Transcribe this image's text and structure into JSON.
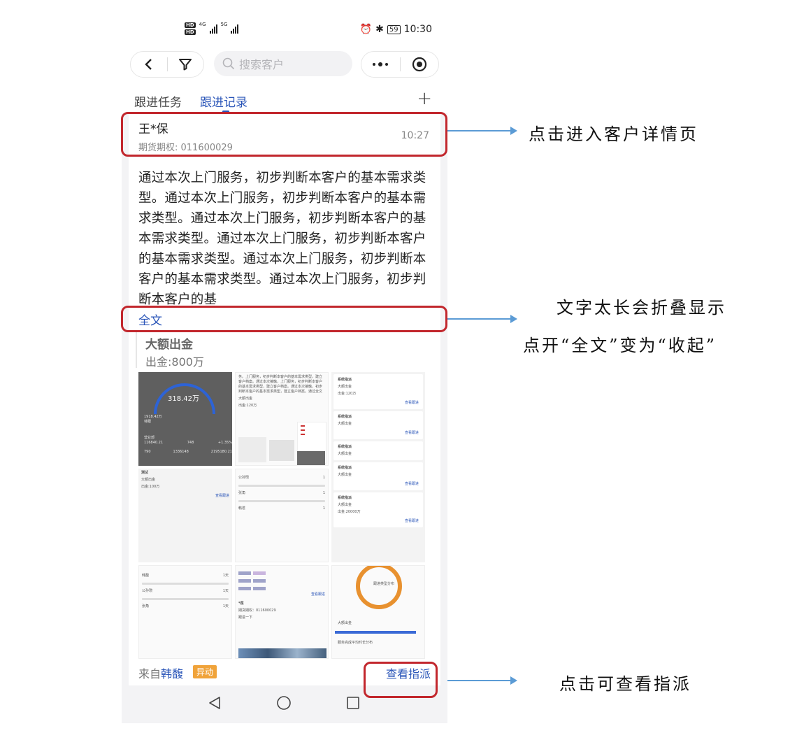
{
  "status_bar": {
    "network_1": "4G",
    "network_2": "5G",
    "hd_label": "HD",
    "battery": "59",
    "time": "10:30"
  },
  "nav": {
    "search_placeholder": "搜索客户",
    "more_icon": "more-dots-icon",
    "target_icon": "target-icon",
    "filter_icon": "filter-icon",
    "back_icon": "back-arrow-icon"
  },
  "tabs": {
    "tab1": "跟进任务",
    "tab2": "跟进记录",
    "active": "跟进记录",
    "add": "+"
  },
  "record": {
    "customer_name": "王*保",
    "customer_sub": "期货期权: 011600029",
    "time": "10:27",
    "body": "通过本次上门服务，初步判断本客户的基本需求类型。通过本次上门服务，初步判断本客户的基本需求类型。通过本次上门服务，初步判断本客户的基本需求类型。通过本次上门服务，初步判断本客户的基本需求类型。通过本次上门服务，初步判断本客户的基本需求类型。通过本次上门服务，初步判断本客户的基",
    "full_text_link": "全文",
    "quote_title": "大额出金",
    "quote_sub": "出金:800万",
    "from_prefix": "来自",
    "from_name": "韩馥",
    "tag": "异动",
    "view_assign": "查看指派"
  },
  "thumbnails": {
    "t1": {
      "big_value": "318.42万",
      "rows": [
        "1918.42万",
        "待跟",
        "营业部",
        "116840.21",
        "748",
        "+1.35%",
        "790",
        "1336148",
        "2195180.21"
      ]
    },
    "t2": {
      "text": "务。上门服务，初步判断本客户的基本需求类型，建立客户档案。通过本次接触，上门服务，初步判断本客户的基本需求类型，建立客户档案。通过本次接触，初步判断本客户的基本需求类型，建立客户档案。通过全文",
      "sub1": "大额出金",
      "sub2": "出金:120万"
    },
    "t3": {
      "title": "系统指派",
      "sub1": "大额出金",
      "sub2": "出金:120万",
      "link": "查看跟进"
    },
    "t4": {
      "title": "测试",
      "sub1": "大额出金",
      "sub2": "出金:100万",
      "link": "查看跟进"
    },
    "t5": {
      "rows": [
        "公孙瓒",
        "张角",
        "韩遂"
      ],
      "counts": [
        "1",
        "1",
        "1"
      ]
    },
    "t6": {
      "title": "系统指派",
      "sub1": "大额出金",
      "sub2": "出金:20000万",
      "link": "查看跟进"
    },
    "t7": {
      "rows": [
        "韩馥",
        "公孙瓒",
        "张角"
      ],
      "counts": [
        "1天",
        "1天",
        "1天"
      ]
    },
    "t8": {
      "title": "*葆",
      "sub": "期货期权：011600029",
      "line": "跟进一下",
      "sub1": "大额出金",
      "sub2": "出金:100万",
      "link": "查看跟进"
    },
    "t9": {
      "title": "跟进类型分布",
      "legend": [
        "",
        "",
        ""
      ],
      "bar_label": "大额出金",
      "footer": "服务完成平均时长分布"
    }
  },
  "annotations": {
    "note1": "点击进入客户详情页",
    "note2_line1": "文字太长会折叠显示",
    "note2_line2": "点开“全文”变为“收起”",
    "note3": "点击可查看指派"
  },
  "colors": {
    "accent_blue": "#2a55b8",
    "highlight_red": "#c2272d",
    "arrow_blue": "#5b9bd5",
    "tag_orange": "#f0a33a",
    "chart_orange": "#e8912f"
  }
}
